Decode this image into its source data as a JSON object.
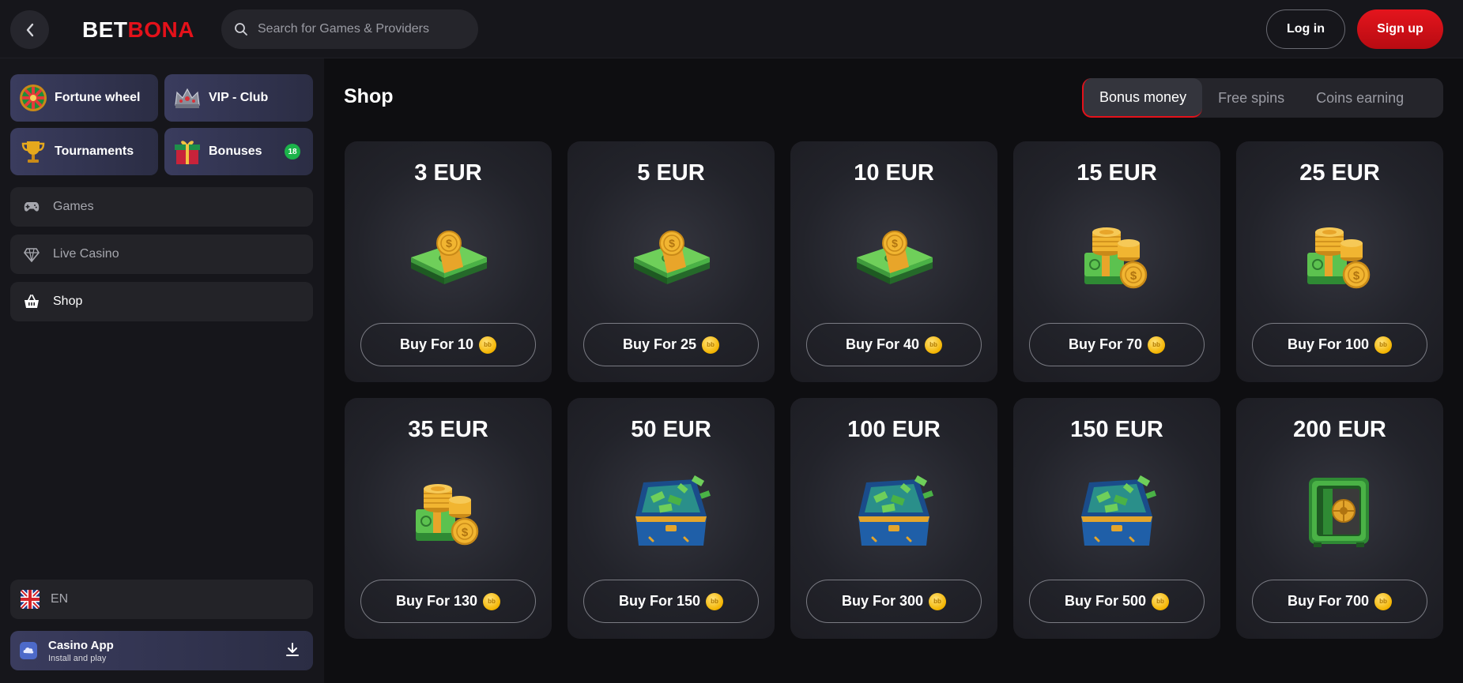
{
  "header": {
    "logo_part1": "BET",
    "logo_part2": "BONA",
    "search_placeholder": "Search for Games & Providers",
    "login_label": "Log in",
    "signup_label": "Sign up"
  },
  "sidebar": {
    "tiles": [
      {
        "label": "Fortune wheel",
        "icon": "fortune-wheel-icon"
      },
      {
        "label": "VIP - Club",
        "icon": "crown-icon"
      },
      {
        "label": "Tournaments",
        "icon": "trophy-icon"
      },
      {
        "label": "Bonuses",
        "icon": "gift-icon",
        "badge": "18"
      }
    ],
    "nav": [
      {
        "label": "Games",
        "icon": "gamepad-icon"
      },
      {
        "label": "Live Casino",
        "icon": "diamond-icon"
      },
      {
        "label": "Shop",
        "icon": "basket-icon"
      }
    ],
    "language": "EN",
    "app": {
      "title": "Casino App",
      "subtitle": "Install and play"
    }
  },
  "main": {
    "title": "Shop",
    "tabs": [
      {
        "label": "Bonus money",
        "active": true
      },
      {
        "label": "Free spins",
        "active": false
      },
      {
        "label": "Coins earning",
        "active": false
      }
    ],
    "items": [
      {
        "amount": "3 EUR",
        "buy_label": "Buy For 10",
        "image": "cash-stack"
      },
      {
        "amount": "5 EUR",
        "buy_label": "Buy For 25",
        "image": "cash-stack"
      },
      {
        "amount": "10 EUR",
        "buy_label": "Buy For 40",
        "image": "cash-stack"
      },
      {
        "amount": "15 EUR",
        "buy_label": "Buy For 70",
        "image": "cash-coins"
      },
      {
        "amount": "25 EUR",
        "buy_label": "Buy For 100",
        "image": "cash-coins"
      },
      {
        "amount": "35 EUR",
        "buy_label": "Buy For 130",
        "image": "cash-coins"
      },
      {
        "amount": "50 EUR",
        "buy_label": "Buy For 150",
        "image": "money-suitcase"
      },
      {
        "amount": "100 EUR",
        "buy_label": "Buy For 300",
        "image": "money-suitcase"
      },
      {
        "amount": "150 EUR",
        "buy_label": "Buy For 500",
        "image": "money-suitcase"
      },
      {
        "amount": "200 EUR",
        "buy_label": "Buy For 700",
        "image": "safe"
      }
    ],
    "coin_text": "bb"
  },
  "colors": {
    "accent_red": "#e4111a",
    "badge_green": "#1bb34a",
    "coin_gold": "#f3b400"
  }
}
